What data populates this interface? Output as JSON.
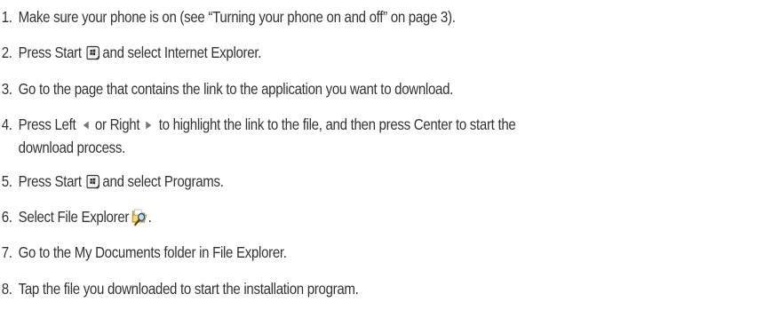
{
  "steps": [
    {
      "num": "1.",
      "text": "Make sure your phone is on (see “Turning your phone on and off” on page 3)."
    },
    {
      "num": "2.",
      "before": "Press Start",
      "after": "and select Internet Explorer.",
      "icon": "start-button-icon"
    },
    {
      "num": "3.",
      "text": "Go to the page that contains the link to the application you want to download."
    },
    {
      "num": "4.",
      "p1": "Press Left",
      "p2": "or Right",
      "p3": "to highlight the link to the file, and then press Center to start the",
      "cont": "download process.",
      "icons": [
        "left-arrow-icon",
        "right-arrow-icon"
      ]
    },
    {
      "num": "5.",
      "before": "Press Start",
      "after": "and select Programs.",
      "icon": "start-button-icon"
    },
    {
      "num": "6.",
      "before": "Select File Explorer",
      "after": ".",
      "icon": "file-explorer-icon"
    },
    {
      "num": "7.",
      "text": "Go to the My Documents folder in File Explorer."
    },
    {
      "num": "8.",
      "text": "Tap the file you downloaded to start the installation program."
    }
  ]
}
